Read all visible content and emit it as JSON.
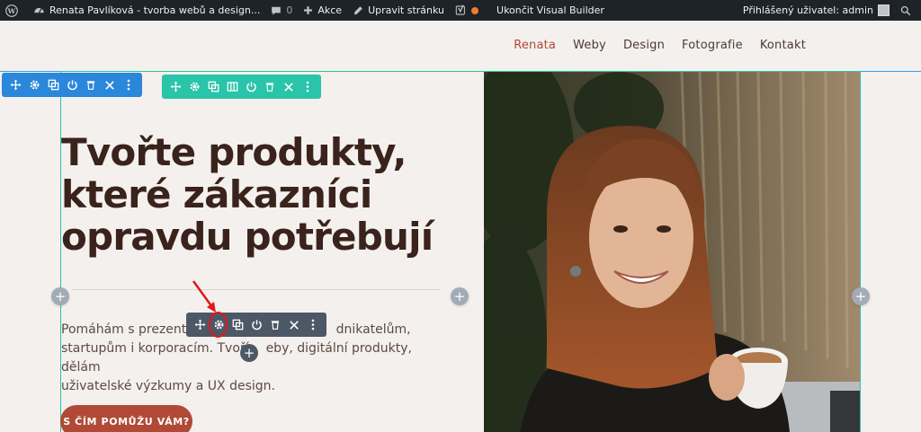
{
  "adminbar": {
    "site_name": "Renata Pavlíková - tvorba webů a design...",
    "comments_count": "0",
    "new_label": "Akce",
    "edit_label": "Upravit stránku",
    "exit_vb_label": "Ukončit Visual Builder",
    "user_label": "Přihlášený uživatel: admin"
  },
  "nav": {
    "items": [
      "Renata",
      "Weby",
      "Design",
      "Fotografie",
      "Kontakt"
    ],
    "active_index": 0,
    "active_color": "#b24a33"
  },
  "hero": {
    "title_lines": [
      "Tvořte produkty,",
      "které zákazníci",
      "opravdu potřebují"
    ],
    "paragraph_part1": "Pomáhám s prezentac",
    "paragraph_part2": "dnikatelům,",
    "paragraph_line2a": "startupům i korporacím. Tvoří",
    "paragraph_line2b": "eby, digitální produkty, dělám",
    "paragraph_line3": "uživatelské výzkumy a UX design.",
    "cta_label": "S ČÍM POMŮŽU VÁM?"
  },
  "colors": {
    "section_toolbar": "#2b87da",
    "row_toolbar": "#29c4a9",
    "module_toolbar": "#4c5866",
    "cta": "#b04a36",
    "annotation": "#e3161a"
  },
  "icons": {
    "section_toolbar": [
      "move-icon",
      "gear-icon",
      "duplicate-icon",
      "power-icon",
      "trash-icon",
      "close-icon",
      "more-icon"
    ],
    "row_toolbar": [
      "move-icon",
      "gear-icon",
      "duplicate-icon",
      "columns-icon",
      "power-icon",
      "trash-icon",
      "close-icon",
      "more-icon"
    ],
    "module_toolbar": [
      "move-icon",
      "gear-icon",
      "duplicate-icon",
      "power-icon",
      "trash-icon",
      "close-icon",
      "more-icon"
    ]
  }
}
